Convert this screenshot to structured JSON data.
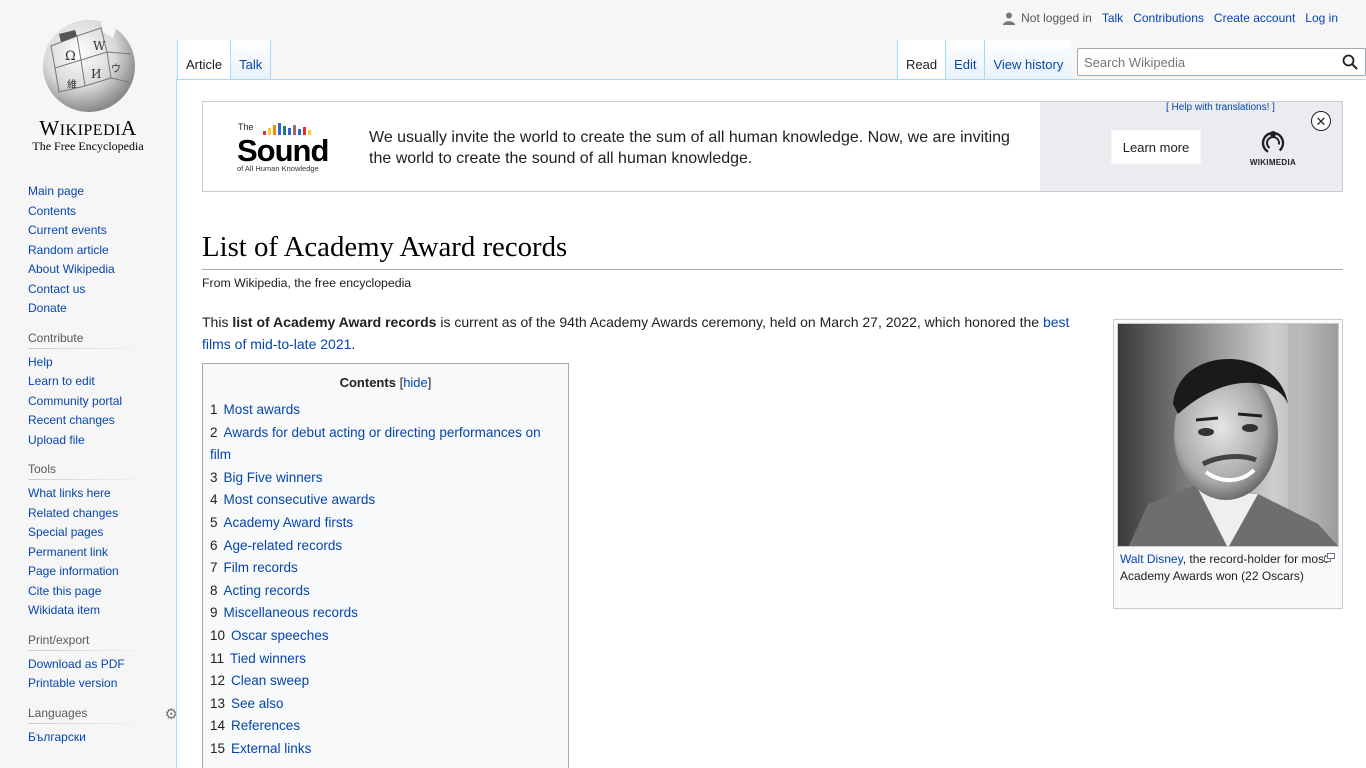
{
  "logo": {
    "wordmark": "Wikipedia",
    "tagline": "The Free Encyclopedia"
  },
  "personal_tools": {
    "status": "Not logged in",
    "talk": "Talk",
    "contributions": "Contributions",
    "create_account": "Create account",
    "login": "Log in"
  },
  "tabs": {
    "article": "Article",
    "talk": "Talk",
    "read": "Read",
    "edit": "Edit",
    "history": "View history"
  },
  "search": {
    "placeholder": "Search Wikipedia"
  },
  "sidebar": {
    "navigation": [
      "Main page",
      "Contents",
      "Current events",
      "Random article",
      "About Wikipedia",
      "Contact us",
      "Donate"
    ],
    "contribute_heading": "Contribute",
    "contribute": [
      "Help",
      "Learn to edit",
      "Community portal",
      "Recent changes",
      "Upload file"
    ],
    "tools_heading": "Tools",
    "tools": [
      "What links here",
      "Related changes",
      "Special pages",
      "Permanent link",
      "Page information",
      "Cite this page",
      "Wikidata item"
    ],
    "print_heading": "Print/export",
    "print": [
      "Download as PDF",
      "Printable version"
    ],
    "languages_heading": "Languages",
    "languages": [
      "Български"
    ]
  },
  "banner": {
    "logo_top": "The",
    "logo_main": "Sound",
    "logo_sub": "of All Human Knowledge",
    "message": "We usually invite the world to create the sum of all human knowledge. Now, we are inviting the world to create the sound of all human knowledge.",
    "help_link": "[ Help with translations! ]",
    "learn_more": "Learn more",
    "wikimedia": "WIKIMEDIA",
    "close": "✕"
  },
  "article": {
    "title": "List of Academy Award records",
    "site_sub": "From Wikipedia, the free encyclopedia",
    "intro_1": "This ",
    "intro_bold": "list of Academy Award records",
    "intro_2": " is current as of the 94th Academy Awards ceremony, held on March 27, 2022, which honored the ",
    "intro_link": "best films of mid-to-late 2021",
    "intro_3": "."
  },
  "toc": {
    "title": "Contents",
    "hide": "hide",
    "items": [
      {
        "num": "1",
        "label": "Most awards"
      },
      {
        "num": "2",
        "label": "Awards for debut acting or directing performances on film"
      },
      {
        "num": "3",
        "label": "Big Five winners"
      },
      {
        "num": "4",
        "label": "Most consecutive awards"
      },
      {
        "num": "5",
        "label": "Academy Award firsts"
      },
      {
        "num": "6",
        "label": "Age-related records"
      },
      {
        "num": "7",
        "label": "Film records"
      },
      {
        "num": "8",
        "label": "Acting records"
      },
      {
        "num": "9",
        "label": "Miscellaneous records"
      },
      {
        "num": "10",
        "label": "Oscar speeches"
      },
      {
        "num": "11",
        "label": "Tied winners"
      },
      {
        "num": "12",
        "label": "Clean sweep"
      },
      {
        "num": "13",
        "label": "See also"
      },
      {
        "num": "14",
        "label": "References"
      },
      {
        "num": "15",
        "label": "External links"
      }
    ]
  },
  "thumbnail": {
    "caption_link": "Walt Disney",
    "caption_text": ", the record-holder for most Academy Awards won (22 Oscars)"
  },
  "colors": {
    "link": "#0645ad",
    "text": "#202122",
    "border": "#a7d7f9"
  }
}
